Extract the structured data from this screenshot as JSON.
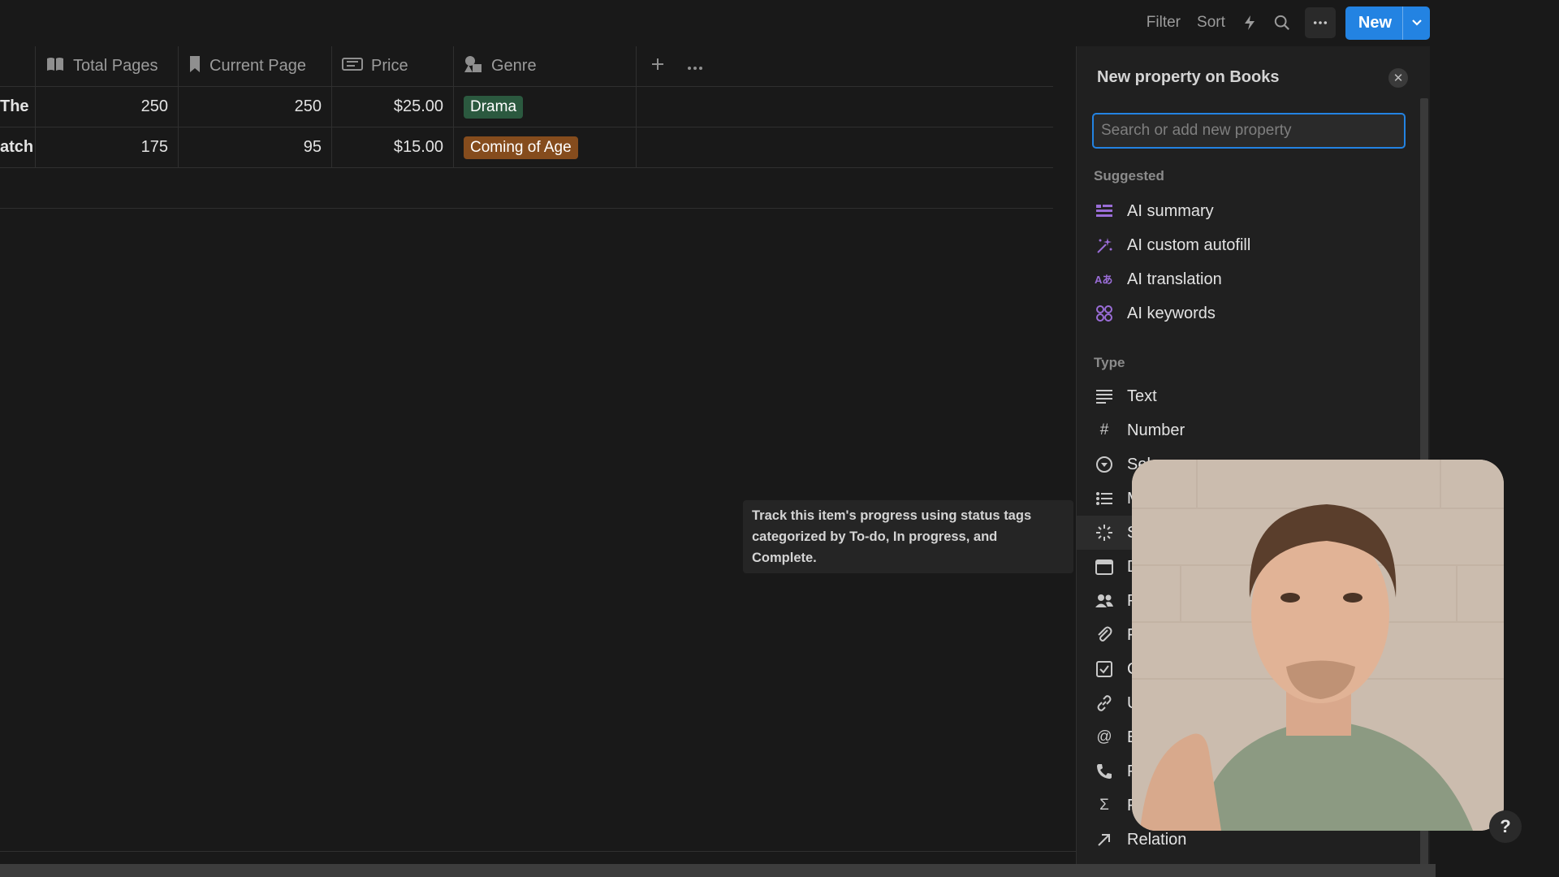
{
  "toolbar": {
    "filter_label": "Filter",
    "sort_label": "Sort",
    "new_label": "New"
  },
  "table": {
    "columns": [
      {
        "label": "Total Pages",
        "icon": "book-icon"
      },
      {
        "label": "Current Page",
        "icon": "bookmark-icon"
      },
      {
        "label": "Price",
        "icon": "ticket-icon"
      },
      {
        "label": "Genre",
        "icon": "shapes-icon"
      }
    ],
    "rows": [
      {
        "title_fragment": "The",
        "total_pages": "250",
        "current_page": "250",
        "price": "$25.00",
        "genre": "Drama",
        "genre_color": "#2b593f"
      },
      {
        "title_fragment": "atch",
        "total_pages": "175",
        "current_page": "95",
        "price": "$15.00",
        "genre": "Coming of Age",
        "genre_color": "#854c1d"
      }
    ]
  },
  "tooltip": {
    "text": "Track this item's progress using status tags categorized by To-do, In progress, and Complete."
  },
  "panel": {
    "title": "New property on Books",
    "search_placeholder": "Search or add new property",
    "suggested_heading": "Suggested",
    "suggested": [
      {
        "label": "AI summary",
        "icon": "ai-summary-icon"
      },
      {
        "label": "AI custom autofill",
        "icon": "sparkle-icon"
      },
      {
        "label": "AI translation",
        "icon": "translation-icon"
      },
      {
        "label": "AI keywords",
        "icon": "keywords-icon"
      }
    ],
    "type_heading": "Type",
    "types": [
      {
        "label": "Text",
        "icon": "text-icon"
      },
      {
        "label": "Number",
        "icon": "hash-icon"
      },
      {
        "label": "Sel",
        "icon": "select-icon"
      },
      {
        "label": "M",
        "icon": "list-icon"
      },
      {
        "label": "S",
        "icon": "status-icon"
      },
      {
        "label": "D",
        "icon": "calendar-icon"
      },
      {
        "label": "P",
        "icon": "people-icon"
      },
      {
        "label": "F",
        "icon": "paperclip-icon"
      },
      {
        "label": "C",
        "icon": "checkbox-icon"
      },
      {
        "label": "U",
        "icon": "link-icon"
      },
      {
        "label": "E",
        "icon": "at-icon"
      },
      {
        "label": "P",
        "icon": "phone-icon"
      },
      {
        "label": "F",
        "icon": "sigma-icon"
      },
      {
        "label": "Relation",
        "icon": "arrow-up-right-icon"
      }
    ]
  },
  "help_label": "?"
}
